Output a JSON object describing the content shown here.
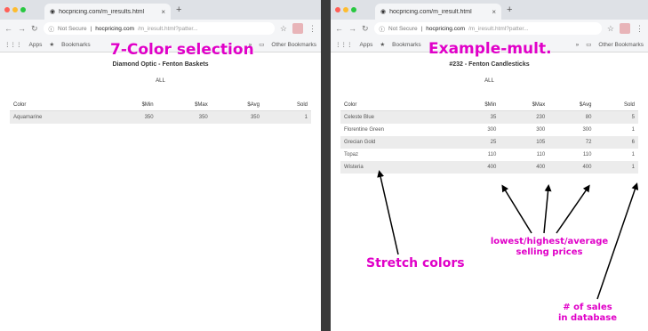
{
  "colors": {
    "accent": "#e000c8",
    "divider": "#3a3a3a"
  },
  "left": {
    "tab_title": "hocpricing.com/m_iresults.html",
    "omnibox": {
      "secure": "Not Secure",
      "domain": "hocpricing.com",
      "path": "/m_iresult.html?patter..."
    },
    "bookmarks": {
      "apps": "Apps",
      "bookmarks": "Bookmarks",
      "other": "Other Bookmarks"
    },
    "page_title": "Diamond Optic - Fenton Baskets",
    "all_label": "ALL",
    "headers": [
      "Color",
      "$Min",
      "$Max",
      "$Avg",
      "Sold"
    ],
    "rows": [
      [
        "Aquamarine",
        "350",
        "350",
        "350",
        "1"
      ]
    ]
  },
  "right": {
    "tab_title": "hocpricing.com/m_iresult.html",
    "omnibox": {
      "secure": "Not Secure",
      "domain": "hocpricing.com",
      "path": "/m_iresult.html?patter..."
    },
    "bookmarks": {
      "apps": "Apps",
      "bookmarks": "Bookmarks",
      "other": "Other Bookmarks"
    },
    "page_title": "#232 - Fenton Candlesticks",
    "all_label": "ALL",
    "headers": [
      "Color",
      "$Min",
      "$Max",
      "$Avg",
      "Sold"
    ],
    "rows": [
      [
        "Celeste Blue",
        "35",
        "230",
        "80",
        "5"
      ],
      [
        "Florentine Green",
        "300",
        "300",
        "300",
        "1"
      ],
      [
        "Grecian Gold",
        "25",
        "105",
        "72",
        "6"
      ],
      [
        "Topaz",
        "110",
        "110",
        "110",
        "1"
      ],
      [
        "Wisteria",
        "400",
        "400",
        "400",
        "1"
      ]
    ]
  },
  "annotations": {
    "color_selection": "7-Color selection",
    "example_mult": "Example-mult.",
    "stretch_colors": "Stretch colors",
    "prices_line1": "lowest/highest/average",
    "prices_line2": "selling prices",
    "sales_line1": "# of sales",
    "sales_line2": "in database"
  }
}
